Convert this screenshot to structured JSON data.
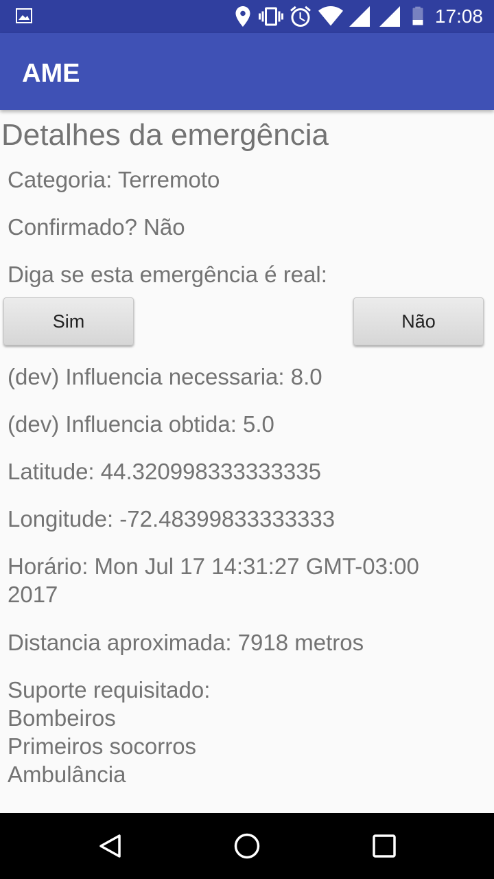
{
  "status_bar": {
    "time": "17:08",
    "icons": [
      "gallery-icon",
      "location-icon",
      "vibrate-icon",
      "alarm-icon",
      "wifi-icon",
      "signal-icon",
      "signal-icon",
      "battery-icon"
    ]
  },
  "app_bar": {
    "title": "AME"
  },
  "details": {
    "heading": "Detalhes da emergência",
    "category": "Categoria: Terremoto",
    "confirmed": "Confirmado? Não",
    "prompt": "Diga se esta emergência é real:",
    "yes_label": "Sim",
    "no_label": "Não",
    "influence_required": "(dev) Influencia necessaria: 8.0",
    "influence_obtained": "(dev) Influencia obtida: 5.0",
    "latitude": "Latitude: 44.320998333333335",
    "longitude": "Longitude: -72.48399833333333",
    "time_line1": "Horário: Mon Jul 17 14:31:27 GMT-03:00",
    "time_line2": "2017",
    "distance": "Distancia aproximada: 7918 metros",
    "support_header": "Suporte requisitado:",
    "support_items": [
      "Bombeiros",
      "Primeiros socorros",
      "Ambulância"
    ]
  },
  "nav_bar": {
    "icons": [
      "back-icon",
      "home-icon",
      "recents-icon"
    ]
  },
  "colors": {
    "status_bar": "#303f9f",
    "app_bar": "#3f51b5",
    "text": "#737373",
    "background": "#fafafa"
  }
}
